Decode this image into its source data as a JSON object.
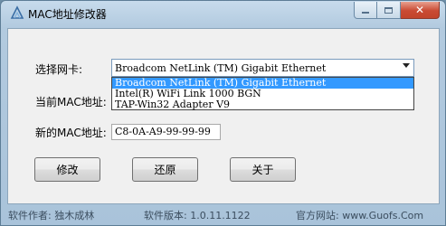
{
  "window": {
    "title": "MAC地址修改器",
    "icon": "app-logo-icon",
    "caption": {
      "minimize": "minimize-icon",
      "maximize": "maximize-icon",
      "close": "close-icon"
    }
  },
  "form": {
    "adapter_label": "选择网卡:",
    "adapter_selected": "Broadcom NetLink (TM) Gigabit Ethernet",
    "adapter_options": [
      "Broadcom NetLink (TM) Gigabit Ethernet",
      "Intel(R) WiFi Link 1000 BGN",
      "TAP-Win32 Adapter V9"
    ],
    "current_mac_label": "当前MAC地址:",
    "new_mac_label": "新的MAC地址:",
    "new_mac_value": "C8-0A-A9-99-99-99"
  },
  "buttons": {
    "modify": "修改",
    "restore": "还原",
    "about": "关于"
  },
  "status": {
    "author": "软件作者: 独木成林",
    "version": "软件版本: 1.0.11.1122",
    "website": "官方网站: www.Guofs.Com"
  },
  "colors": {
    "selection": "#3399ff",
    "close_button": "#c94a33",
    "client_bg": "#f0f0f0"
  }
}
